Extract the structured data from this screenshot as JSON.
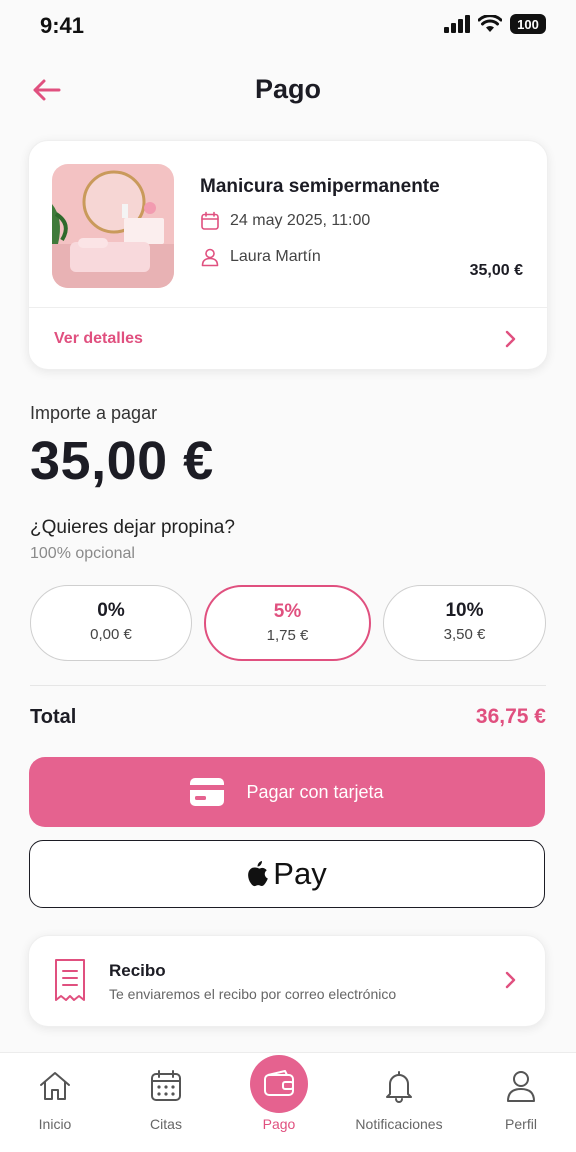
{
  "status_bar": {
    "time": "9:41",
    "battery": "100"
  },
  "header": {
    "title": "Pago"
  },
  "booking": {
    "service_name": "Manicura semipermanente",
    "date": "24 may 2025, 11:00",
    "professional": "Laura Martín",
    "price": "35,00 €",
    "details_link": "Ver detalles"
  },
  "payment": {
    "amount_label": "Importe a pagar",
    "amount_value": "35,00 €",
    "tip_question": "¿Quieres dejar propina?",
    "tip_optional": "100% opcional",
    "tip_options": [
      {
        "percent": "0%",
        "amount": "0,00 €",
        "selected": false
      },
      {
        "percent": "5%",
        "amount": "1,75 €",
        "selected": true
      },
      {
        "percent": "10%",
        "amount": "3,50 €",
        "selected": false
      }
    ],
    "total_label": "Total",
    "total_value": "36,75 €",
    "pay_card_label": "Pagar con tarjeta",
    "apple_pay_label": "Pay"
  },
  "receipt": {
    "title": "Recibo",
    "description": "Te enviaremos el recibo por correo electrónico"
  },
  "nav": {
    "items": [
      {
        "label": "Inicio",
        "icon": "home-icon"
      },
      {
        "label": "Citas",
        "icon": "calendar-icon"
      },
      {
        "label": "Pago",
        "icon": "wallet-icon",
        "active": true
      },
      {
        "label": "Notificaciones",
        "icon": "bell-icon"
      },
      {
        "label": "Perfil",
        "icon": "user-icon"
      }
    ]
  },
  "colors": {
    "accent": "#e0507f",
    "button": "#e5628f",
    "text": "#1c1c24"
  }
}
